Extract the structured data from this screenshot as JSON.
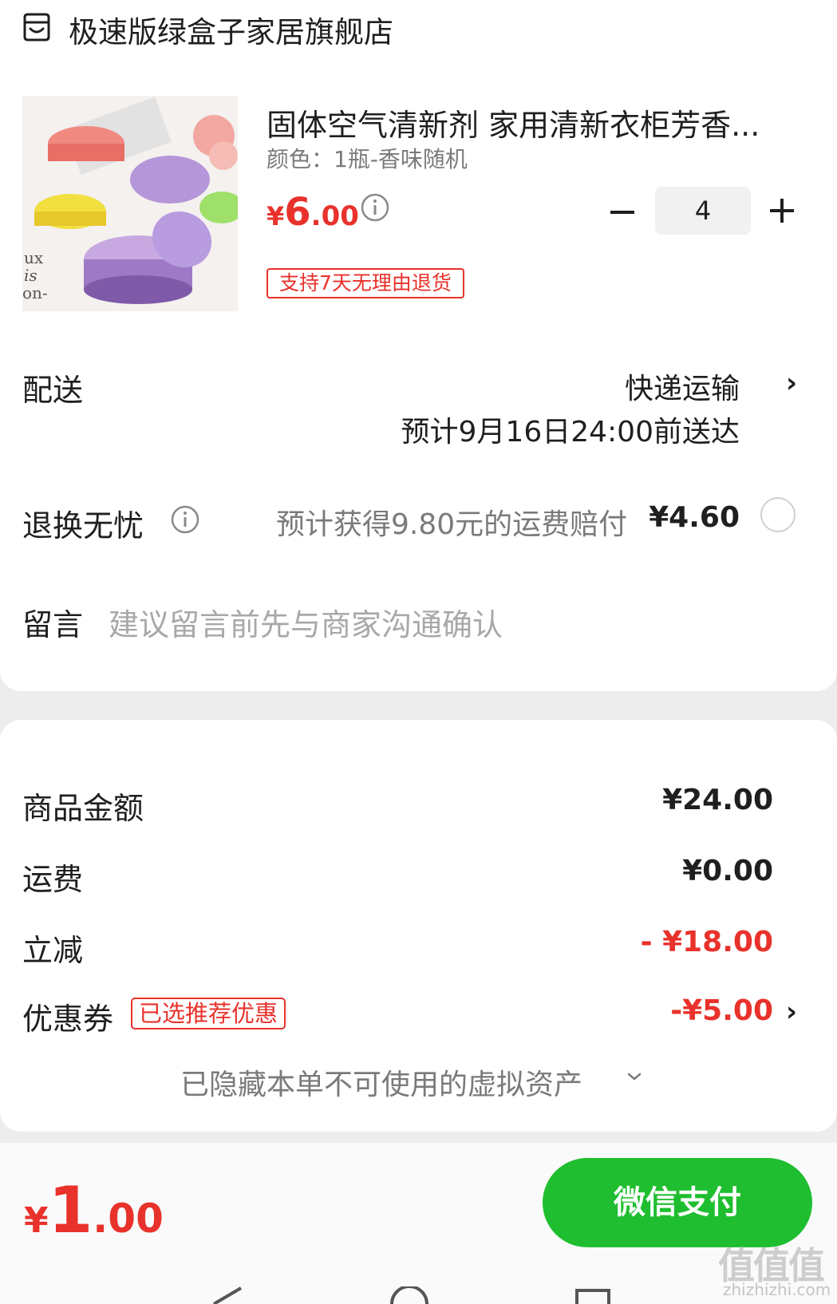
{
  "shop": {
    "name": "极速版绿盒子家居旗舰店",
    "icon": "store-icon"
  },
  "product": {
    "title": "固体空气清新剂 家用清新衣柜芳香...",
    "spec": "颜色：1瓶-香味随机",
    "price_currency": "¥",
    "price_int": "6",
    "price_dec": ".00",
    "quantity": "4",
    "return_badge": "支持7天无理由退货"
  },
  "delivery": {
    "label": "配送",
    "method": "快递运输",
    "eta": "预计9月16日24:00前送达"
  },
  "return_worry": {
    "label": "退换无忧",
    "desc": "预计获得9.80元的运费赔付",
    "price": "¥4.60"
  },
  "message": {
    "label": "留言",
    "placeholder": "建议留言前先与商家沟通确认"
  },
  "summary": {
    "goods_label": "商品金额",
    "goods_value": "¥24.00",
    "shipping_label": "运费",
    "shipping_value": "¥0.00",
    "discount_label": "立减",
    "discount_value": "- ¥18.00",
    "coupon_label": "优惠券",
    "coupon_badge": "已选推荐优惠",
    "coupon_value": "-¥5.00",
    "hidden_note": "已隐藏本单不可使用的虚拟资产"
  },
  "footer": {
    "total_currency": "¥",
    "total_int": "1",
    "total_dec": ".00",
    "pay_label": "微信支付"
  },
  "watermark": {
    "main": "值值值",
    "sub": "zhizhizhi.com"
  },
  "colors": {
    "accent_red": "#e8322b",
    "pay_green": "#1fbe30"
  }
}
